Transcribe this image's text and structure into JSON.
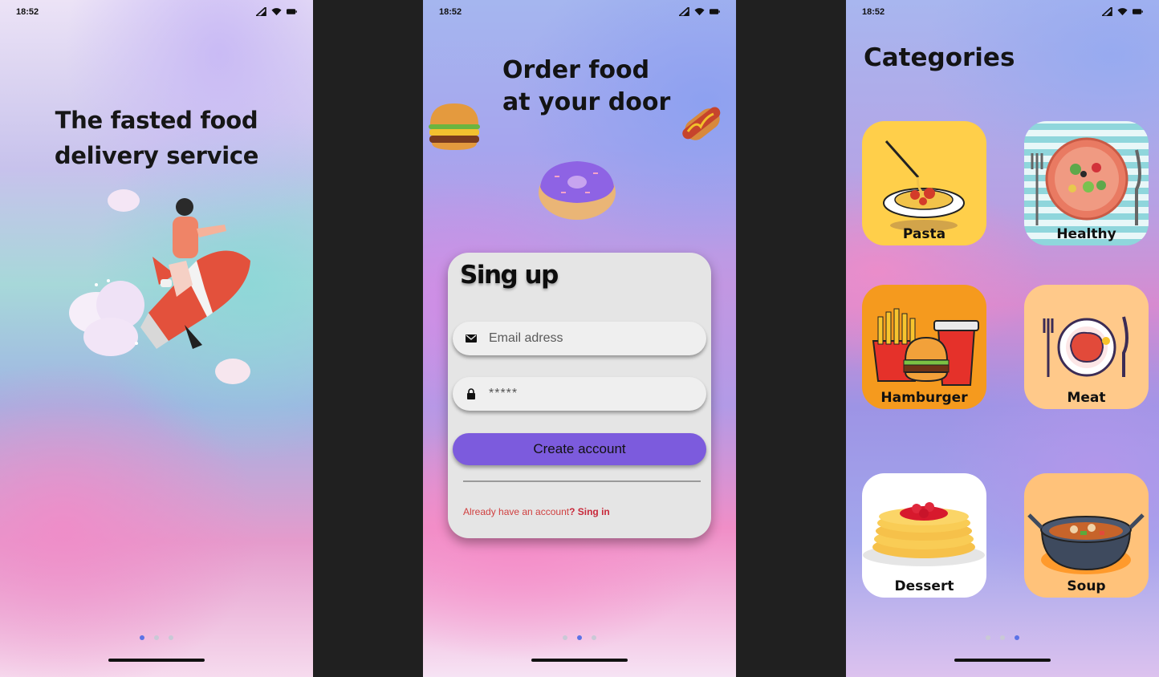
{
  "status_bar": {
    "time": "18:52"
  },
  "screen1": {
    "headline_line1": "The fasted food",
    "headline_line2": "delivery service",
    "pager": {
      "total": 3,
      "active": 1
    }
  },
  "screen2": {
    "headline_line1": "Order food",
    "headline_line2": "at your door",
    "card": {
      "title": "Sing up",
      "email_placeholder": "Email adress",
      "password_value": "*****",
      "create_button": "Create account",
      "already_text": "Already have an account",
      "signin_link": "? Sing in"
    },
    "pager": {
      "total": 3,
      "active": 2
    }
  },
  "screen3": {
    "title": "Categories",
    "categories": [
      {
        "label": "Pasta",
        "icon": "pasta-icon",
        "bg": "#ffcf4a"
      },
      {
        "label": "Healthy",
        "icon": "salad-icon",
        "bg": "#8fd6dc"
      },
      {
        "label": "Hamburger",
        "icon": "hamburger-icon",
        "bg": "#f59a1e"
      },
      {
        "label": "Meat",
        "icon": "steak-icon",
        "bg": "#ffc98a"
      },
      {
        "label": "Dessert",
        "icon": "pancake-icon",
        "bg": "#ffffff"
      },
      {
        "label": "Soup",
        "icon": "soup-icon",
        "bg": "#ffc27a"
      }
    ],
    "pager": {
      "total": 3,
      "active": 3
    }
  }
}
